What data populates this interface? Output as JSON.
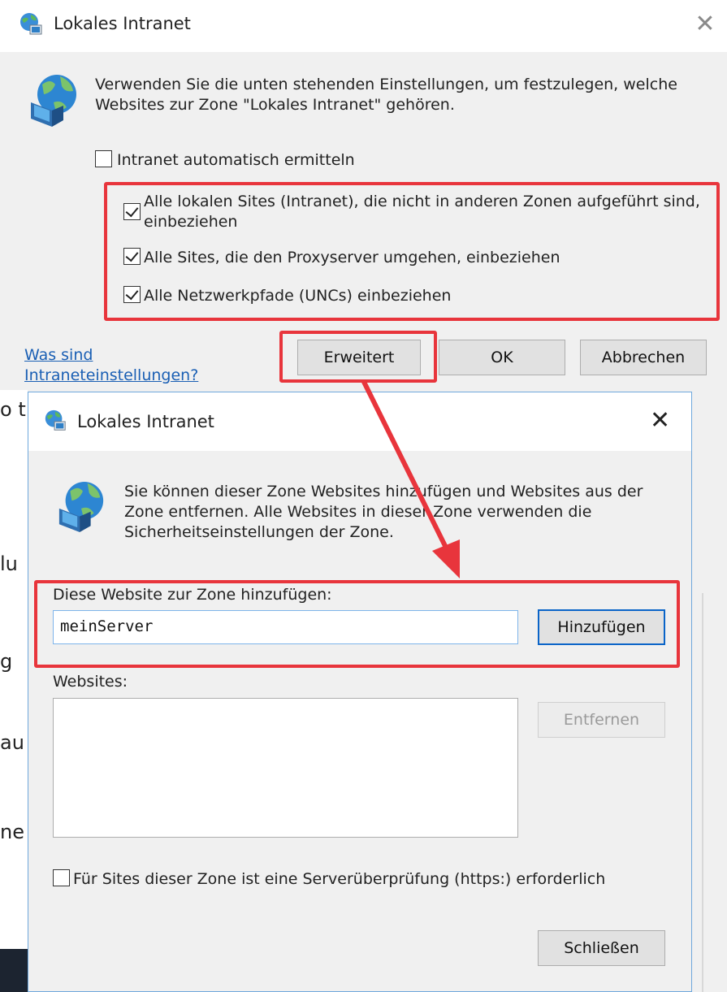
{
  "colors": {
    "annotation_red": "#e8353c",
    "link_blue": "#1a5fb4",
    "dialog_bg": "#f0f0f0",
    "focus_blue": "#0a64c8"
  },
  "outer_dialog": {
    "title": "Lokales Intranet",
    "title_icon": "intranet-globe-icon",
    "close_glyph": "✕",
    "description": "Verwenden Sie die unten stehenden Einstellungen, um festzulegen, welche Websites zur Zone \"Lokales Intranet\" gehören.",
    "checkboxes": [
      {
        "label": "Intranet automatisch ermitteln",
        "checked": false
      },
      {
        "label": "Alle lokalen Sites (Intranet), die nicht in anderen Zonen aufgeführt sind, einbeziehen",
        "checked": true
      },
      {
        "label": "Alle Sites, die den Proxyserver umgehen, einbeziehen",
        "checked": true
      },
      {
        "label": "Alle Netzwerkpfade (UNCs) einbeziehen",
        "checked": true
      }
    ],
    "help_link": "Was sind Intraneteinstellungen?",
    "buttons": {
      "advanced": "Erweitert",
      "ok": "OK",
      "cancel": "Abbrechen"
    }
  },
  "background_fragments": [
    "o t",
    "lu",
    "g",
    "au",
    "ne"
  ],
  "inner_dialog": {
    "title": "Lokales Intranet",
    "close_glyph": "✕",
    "description": "Sie können dieser Zone Websites hinzufügen und Websites aus der Zone entfernen. Alle Websites in dieser Zone verwenden die Sicherheitseinstellungen der Zone.",
    "add_label": "Diese Website zur Zone hinzufügen:",
    "add_value": "meinServer",
    "add_button": "Hinzufügen",
    "websites_label": "Websites:",
    "websites": [],
    "remove_button": "Entfernen",
    "https_checkbox": {
      "label": "Für Sites dieser Zone ist eine Serverüberprüfung (https:) erforderlich",
      "checked": false
    },
    "close_button": "Schließen"
  }
}
